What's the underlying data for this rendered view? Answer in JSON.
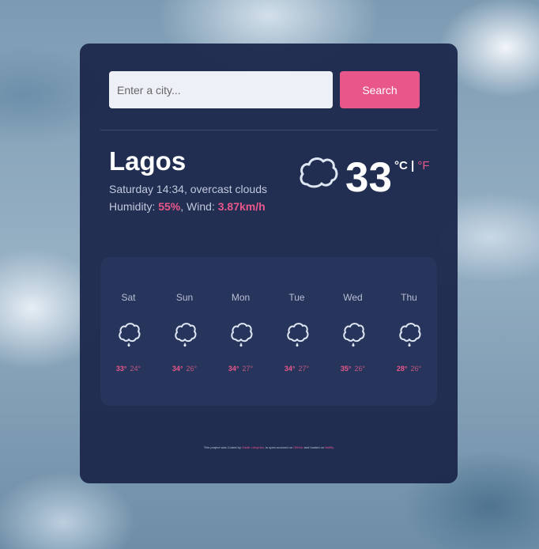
{
  "search": {
    "placeholder": "Enter a city...",
    "value": "",
    "button_label": "Search"
  },
  "current": {
    "city": "Lagos",
    "description": "Saturday 14:34, overcast clouds",
    "humidity_label": "Humidity: ",
    "humidity": "55%",
    "wind_label": ", Wind: ",
    "wind": "3.87km/h",
    "temperature": "33",
    "unit_c": "°C",
    "unit_sep": " | ",
    "unit_f": "°F",
    "icon": "cloud-icon"
  },
  "forecast": [
    {
      "day": "Sat",
      "high": "33°",
      "low": "24°",
      "icon": "rain-cloud-icon"
    },
    {
      "day": "Sun",
      "high": "34°",
      "low": "26°",
      "icon": "rain-cloud-icon"
    },
    {
      "day": "Mon",
      "high": "34°",
      "low": "27°",
      "icon": "rain-cloud-icon"
    },
    {
      "day": "Tue",
      "high": "34°",
      "low": "27°",
      "icon": "rain-cloud-icon"
    },
    {
      "day": "Wed",
      "high": "35°",
      "low": "26°",
      "icon": "rain-cloud-icon"
    },
    {
      "day": "Thu",
      "high": "28°",
      "low": "26°",
      "icon": "rain-cloud-icon"
    }
  ],
  "footer": {
    "text1": "This project was Coded by ",
    "author": "Oadlir Ldeyinka",
    "text2": ", is open-sourced on ",
    "repo": "GitHub",
    "text3": " and hosted on ",
    "host": "Netlify"
  },
  "colors": {
    "accent": "#e9578a",
    "card": "#1b264a",
    "text": "#ffffff"
  }
}
